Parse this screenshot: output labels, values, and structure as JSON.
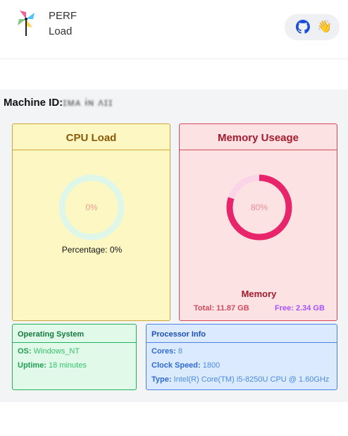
{
  "header": {
    "brand_line1": "PERF",
    "brand_line2": "Load",
    "github_icon": "github-icon",
    "wave_icon": "waving-hand-icon",
    "wave_glyph": "👋"
  },
  "machine": {
    "label": "Machine ID:",
    "value": "ɪᴍᴀ ɨɴ ʌɪɪ"
  },
  "cpu": {
    "title": "CPU Load",
    "ring_text": "0%",
    "percent": 0,
    "percentage_text": "Percentage: 0%",
    "ring_color": "#dff7e9"
  },
  "memory": {
    "title": "Memory Useage",
    "ring_text": "80%",
    "percent": 80,
    "label": "Memory",
    "total": "Total: 11.87 GB",
    "free": "Free: 2.34 GB",
    "used_color": "#e8246a",
    "track_color": "#fbd5e7"
  },
  "os": {
    "title": "Operating System",
    "os_label": "OS:",
    "os_value": "Windows_NT",
    "uptime_label": "Uptime:",
    "uptime_value": "18 minutes"
  },
  "processor": {
    "title": "Processor Info",
    "cores_label": "Cores:",
    "cores_value": "8",
    "clock_label": "Clock Speed:",
    "clock_value": "1800",
    "type_label": "Type:",
    "type_value": "Intel(R) Core(TM) i5-8250U CPU @ 1.60GHz"
  }
}
